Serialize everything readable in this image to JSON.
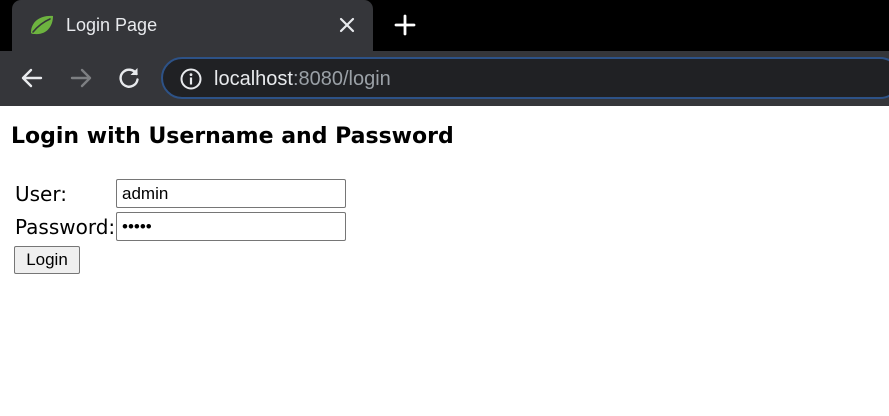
{
  "browser": {
    "tab": {
      "title": "Login Page",
      "favicon": "spring-leaf-icon"
    },
    "close_tab_icon": "close-icon",
    "new_tab_icon": "plus-icon",
    "nav": {
      "back_icon": "back-arrow-icon",
      "forward_icon": "forward-arrow-icon",
      "reload_icon": "reload-icon"
    },
    "address_bar": {
      "info_icon": "info-icon",
      "host": "localhost",
      "rest": ":8080/login"
    },
    "colors": {
      "tabstrip": "#000000",
      "toolbar": "#35363a",
      "omnibox": "#202124",
      "omnibox_border": "#2d5287",
      "favicon": "#6db33f"
    }
  },
  "page": {
    "title": "Login with Username and Password",
    "form": {
      "user_label": "User:",
      "user_value": "admin",
      "password_label": "Password:",
      "password_value": "•••••",
      "submit_label": "Login"
    }
  }
}
